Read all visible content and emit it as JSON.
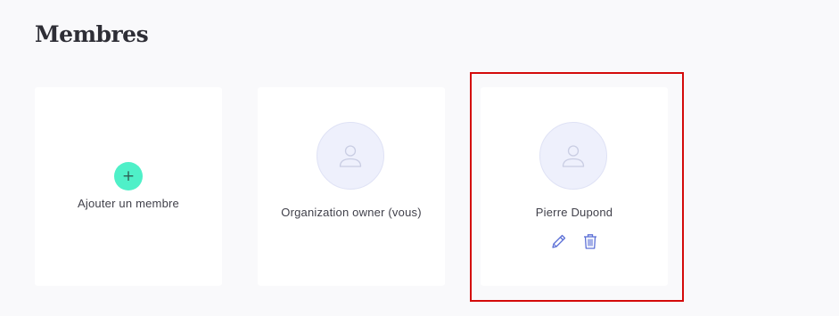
{
  "page": {
    "title": "Membres"
  },
  "add_card": {
    "button_symbol": "+",
    "label": "Ajouter un membre",
    "icon": "plus-icon",
    "accent_color": "#4ff0c8"
  },
  "members": [
    {
      "name": "Organization owner (vous)",
      "avatar_icon": "user-icon",
      "actions": []
    },
    {
      "name": "Pierre Dupond",
      "avatar_icon": "user-icon",
      "actions": [
        "edit-icon",
        "trash-icon"
      ]
    }
  ],
  "colors": {
    "background": "#f9f9fb",
    "card": "#ffffff",
    "avatar_bg": "#eef0fc",
    "icon_blue": "#5b6fd6",
    "highlight": "#d40a0a"
  }
}
